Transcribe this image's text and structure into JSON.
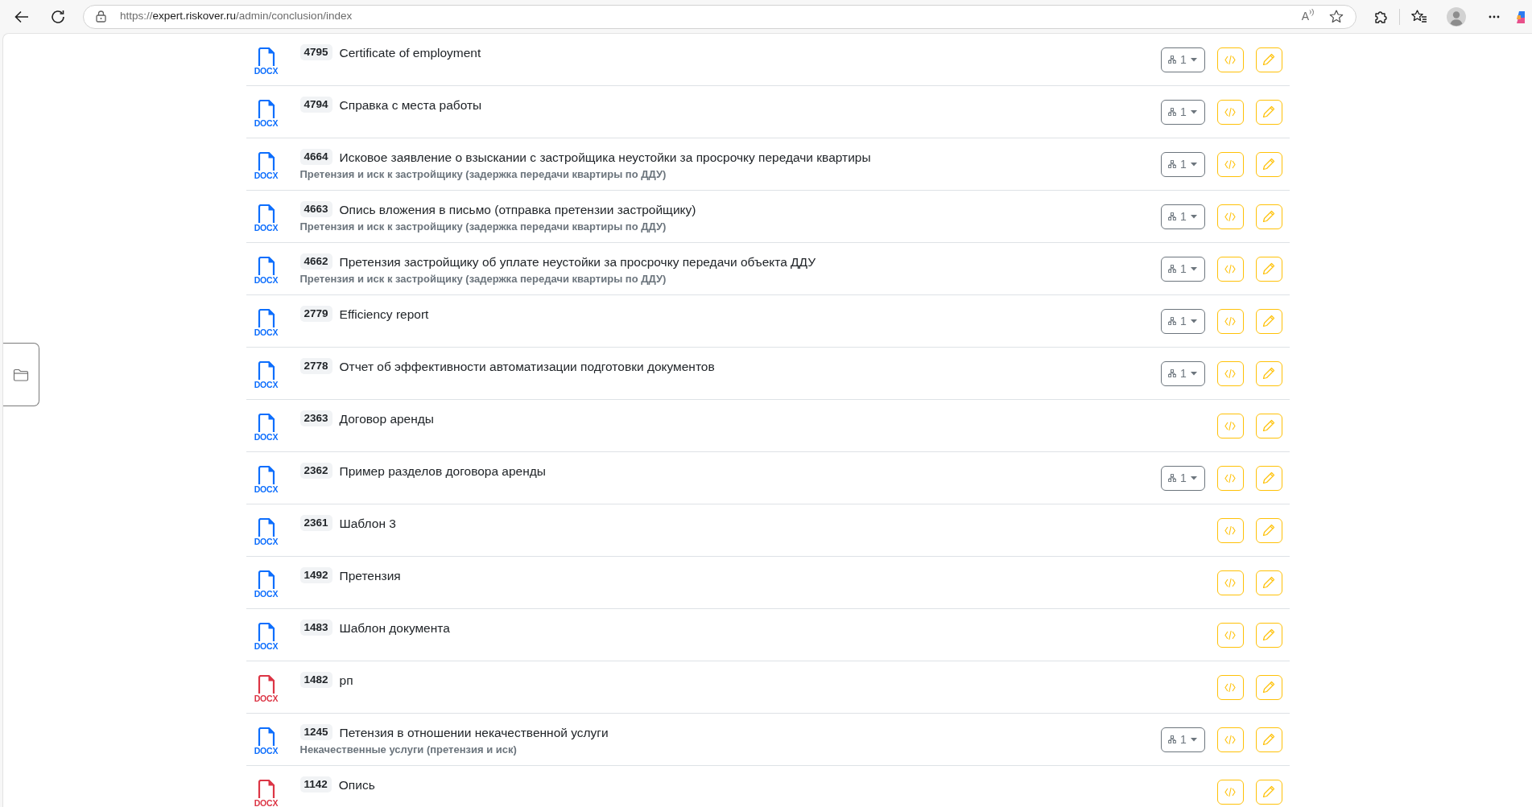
{
  "browser": {
    "address_bar": {
      "scheme": "https://",
      "host": "expert.riskover.ru",
      "path": "/admin/conclusion/index"
    },
    "read_aloud_glyph": "A"
  },
  "documents": [
    {
      "number": "4795",
      "title": "Certificate of employment",
      "file_type": "DOCX",
      "color": "#0d6efd",
      "structure_button": {
        "label": "1"
      }
    },
    {
      "number": "4794",
      "title": "Справка с места работы",
      "file_type": "DOCX",
      "color": "#0d6efd",
      "structure_button": {
        "label": "1"
      }
    },
    {
      "number": "4664",
      "title": "Исковое заявление о взыскании с застройщика неустойки за просрочку передачи квартиры",
      "category": "Претензия и иск к застройщику (задержка передачи квартиры по ДДУ)",
      "file_type": "DOCX",
      "color": "#0d6efd",
      "structure_button": {
        "label": "1"
      }
    },
    {
      "number": "4663",
      "title": "Опись вложения в письмо (отправка претензии застройщику)",
      "category": "Претензия и иск к застройщику (задержка передачи квартиры по ДДУ)",
      "file_type": "DOCX",
      "color": "#0d6efd",
      "structure_button": {
        "label": "1"
      }
    },
    {
      "number": "4662",
      "title": "Претензия застройщику об уплате неустойки за просрочку передачи объекта ДДУ",
      "category": "Претензия и иск к застройщику (задержка передачи квартиры по ДДУ)",
      "file_type": "DOCX",
      "color": "#0d6efd",
      "structure_button": {
        "label": "1"
      }
    },
    {
      "number": "2779",
      "title": "Efficiency report",
      "file_type": "DOCX",
      "color": "#0d6efd",
      "structure_button": {
        "label": "1"
      }
    },
    {
      "number": "2778",
      "title": "Отчет об эффективности автоматизации подготовки документов",
      "file_type": "DOCX",
      "color": "#0d6efd",
      "structure_button": {
        "label": "1"
      }
    },
    {
      "number": "2363",
      "title": "Договор аренды",
      "file_type": "DOCX",
      "color": "#0d6efd"
    },
    {
      "number": "2362",
      "title": "Пример разделов договора аренды",
      "file_type": "DOCX",
      "color": "#0d6efd",
      "structure_button": {
        "label": "1"
      }
    },
    {
      "number": "2361",
      "title": "Шаблон 3",
      "file_type": "DOCX",
      "color": "#0d6efd"
    },
    {
      "number": "1492",
      "title": "Претензия",
      "file_type": "DOCX",
      "color": "#0d6efd"
    },
    {
      "number": "1483",
      "title": "Шаблон документа",
      "file_type": "DOCX",
      "color": "#0d6efd"
    },
    {
      "number": "1482",
      "title": "рп",
      "file_type": "DOCX",
      "color": "#dc3545"
    },
    {
      "number": "1245",
      "title": "Петензия в отношении некачественной услуги",
      "category": "Некачественные услуги (претензия и иск)",
      "file_type": "DOCX",
      "color": "#0d6efd",
      "structure_button": {
        "label": "1"
      }
    },
    {
      "number": "1142",
      "title": "Опись",
      "file_type": "DOCX",
      "color": "#dc3545"
    }
  ]
}
